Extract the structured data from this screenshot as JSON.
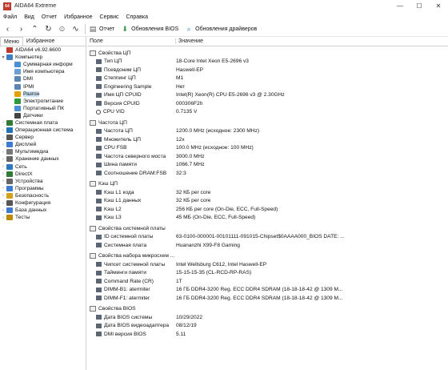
{
  "window": {
    "title": "AIDA64 Extreme",
    "app_icon": "64",
    "minimize": "—",
    "maximize": "☐",
    "close": "✕"
  },
  "menu": [
    "Файл",
    "Вид",
    "Отчет",
    "Избранное",
    "Сервис",
    "Справка"
  ],
  "toolbar": {
    "report": "Отчет",
    "bios_updates": "Обновления BIOS",
    "driver_updates": "Обновления драйверов"
  },
  "left_tabs": {
    "menu": "Меню",
    "favorites": "Избранное"
  },
  "tree": [
    {
      "label": "AIDA64 v6.92.6600",
      "depth": 0,
      "exp": "",
      "color": "#c0392b"
    },
    {
      "label": "Компьютер",
      "depth": 0,
      "exp": "▼",
      "color": "#3d7fc4"
    },
    {
      "label": "Суммарная информ",
      "depth": 1,
      "exp": "",
      "color": "#4a90d9"
    },
    {
      "label": "Имя компьютера",
      "depth": 1,
      "exp": "",
      "color": "#6a9fd4"
    },
    {
      "label": "DMI",
      "depth": 1,
      "exp": "",
      "color": "#5b87b5"
    },
    {
      "label": "IPMI",
      "depth": 1,
      "exp": "",
      "color": "#5b87b5"
    },
    {
      "label": "Разгон",
      "depth": 1,
      "exp": "",
      "color": "#e8a000",
      "selected": true
    },
    {
      "label": "Электропитание",
      "depth": 1,
      "exp": "",
      "color": "#2e9b3b"
    },
    {
      "label": "Портативный ПК",
      "depth": 1,
      "exp": "",
      "color": "#4a90d9"
    },
    {
      "label": "Датчики",
      "depth": 1,
      "exp": "",
      "color": "#444444"
    },
    {
      "label": "Системная плата",
      "depth": 0,
      "exp": "›",
      "color": "#2e7d32"
    },
    {
      "label": "Операционная система",
      "depth": 0,
      "exp": "›",
      "color": "#1e73be"
    },
    {
      "label": "Сервер",
      "depth": 0,
      "exp": "›",
      "color": "#555555"
    },
    {
      "label": "Дисплей",
      "depth": 0,
      "exp": "›",
      "color": "#3a7bd5"
    },
    {
      "label": "Мультимедиа",
      "depth": 0,
      "exp": "›",
      "color": "#777777"
    },
    {
      "label": "Хранение данных",
      "depth": 0,
      "exp": "›",
      "color": "#666666"
    },
    {
      "label": "Сеть",
      "depth": 0,
      "exp": "›",
      "color": "#2b78c5"
    },
    {
      "label": "DirectX",
      "depth": 0,
      "exp": "›",
      "color": "#2e7d32"
    },
    {
      "label": "Устройства",
      "depth": 0,
      "exp": "›",
      "color": "#666666"
    },
    {
      "label": "Программы",
      "depth": 0,
      "exp": "›",
      "color": "#3a7bd5"
    },
    {
      "label": "Безопасность",
      "depth": 0,
      "exp": "›",
      "color": "#d4a017"
    },
    {
      "label": "Конфигурация",
      "depth": 0,
      "exp": "›",
      "color": "#555555"
    },
    {
      "label": "База данных",
      "depth": 0,
      "exp": "›",
      "color": "#3a7bd5"
    },
    {
      "label": "Тесты",
      "depth": 0,
      "exp": "›",
      "color": "#c08a00"
    }
  ],
  "columns": {
    "field": "Поле",
    "value": "Значение"
  },
  "sections": [
    {
      "title": "Свойства ЦП",
      "rows": [
        {
          "name": "Тип ЦП",
          "value": "18-Core Intel Xeon E5-2696 v3"
        },
        {
          "name": "Псевдоним ЦП",
          "value": "Haswell-EP"
        },
        {
          "name": "Степпинг ЦП",
          "value": "M1"
        },
        {
          "name": "Engineering Sample",
          "value": "Нет"
        },
        {
          "name": "Имя ЦП CPUID",
          "value": "Intel(R) Xeon(R) CPU E5-2696 v3 @ 2.30GHz"
        },
        {
          "name": "Версия CPUID",
          "value": "000306F2h"
        },
        {
          "name": "CPU VID",
          "value": "0.7135 V",
          "radio": true
        }
      ]
    },
    {
      "title": "Частота ЦП",
      "rows": [
        {
          "name": "Частота ЦП",
          "value": "1200.0 MHz  (исходное: 2300 MHz)"
        },
        {
          "name": "Множитель ЦП",
          "value": "12x"
        },
        {
          "name": "CPU FSB",
          "value": "100.0 MHz  (исходное: 100 MHz)"
        },
        {
          "name": "Частота северного моста",
          "value": "3000.0 MHz"
        },
        {
          "name": "Шина памяти",
          "value": "1066.7 MHz"
        },
        {
          "name": "Соотношение DRAM:FSB",
          "value": "32:3"
        }
      ]
    },
    {
      "title": "Кэш ЦП",
      "rows": [
        {
          "name": "Кэш L1 кода",
          "value": "32 КБ per core"
        },
        {
          "name": "Кэш L1 данных",
          "value": "32 КБ per core"
        },
        {
          "name": "Кэш L2",
          "value": "256 КБ per core  (On-Die, ECC, Full-Speed)"
        },
        {
          "name": "Кэш L3",
          "value": "45 МБ  (On-Die, ECC, Full-Speed)"
        }
      ]
    },
    {
      "title": "Свойства системной платы",
      "rows": [
        {
          "name": "ID системной платы",
          "value": "63-0100-000001-00101111-091015-Chipset$0AAAA000_BIOS DATE: ..."
        },
        {
          "name": "Системная плата",
          "value": "Huananzhi X99-F8 Gaming"
        }
      ]
    },
    {
      "title": "Свойства набора микросхем ...",
      "rows": [
        {
          "name": "Чипсет системной платы",
          "value": "Intel Wellsburg C612, Intel Haswell-EP"
        },
        {
          "name": "Тайминги памяти",
          "value": "15-15-15-35  (CL-RCD-RP-RAS)"
        },
        {
          "name": "Command Rate (CR)",
          "value": "1T"
        },
        {
          "name": "DIMM-B1: atermiter",
          "value": "16 ГБ DDR4-3200 Reg. ECC DDR4 SDRAM  (18-18-18-42 @ 1309 M..."
        },
        {
          "name": "DIMM-F1: atermiter",
          "value": "16 ГБ DDR4-3200 Reg. ECC DDR4 SDRAM  (18-18-18-42 @ 1309 M..."
        }
      ]
    },
    {
      "title": "Свойства BIOS",
      "rows": [
        {
          "name": "Дата BIOS системы",
          "value": "10/29/2022"
        },
        {
          "name": "Дата BIOS видеоадаптера",
          "value": "08/12/19"
        },
        {
          "name": "DMI версия BIOS",
          "value": "5.11"
        }
      ]
    }
  ]
}
